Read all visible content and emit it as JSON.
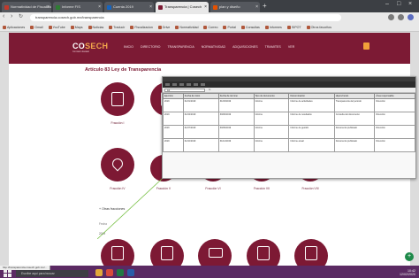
{
  "browser": {
    "tabs": [
      {
        "label": "Normatividad de Fiscaliza",
        "active": false
      },
      {
        "label": "Informe FIS",
        "active": false
      },
      {
        "label": "Cuenta 2019",
        "active": false
      },
      {
        "label": "Transparencia | Cosech",
        "active": true
      },
      {
        "label": "plan y diseño",
        "active": false
      }
    ],
    "new_tab": "+",
    "url": "transparencia.cosech.gob.mx/transparencia",
    "bookmarks": [
      "Aplicaciones",
      "Gmail",
      "YouTube",
      "Maps",
      "Noticias",
      "Traducir",
      "Fiscalizacion",
      "Drive",
      "Normatividad",
      "Correo",
      "Portal",
      "Consultas",
      "Informes",
      "SIPOT",
      "Otros favoritos"
    ]
  },
  "site": {
    "logo": {
      "text_a": "CO",
      "text_b": "SECH",
      "tagline": "Comision Estatal"
    },
    "nav": [
      "INICIO",
      "DIRECTORIO",
      "TRANSPARENCIA",
      "NORMATIVIDAD",
      "ADQUISICIONES",
      "TRAMITES",
      "VER"
    ],
    "page_title": "Artículo 83 Ley de Transparencia",
    "tiles_row1": [
      {
        "label": "Fracción I"
      },
      {
        "label": "Fracción II"
      }
    ],
    "tiles_row2": [
      {
        "label": "Fracción IV"
      },
      {
        "label": "Fracción V"
      },
      {
        "label": "Fracción VI"
      },
      {
        "label": "Fracción VII"
      },
      {
        "label": "Fracción VIII"
      }
    ],
    "tiles_row3": [
      {
        "label": ""
      },
      {
        "label": ""
      },
      {
        "label": ""
      },
      {
        "label": ""
      },
      {
        "label": ""
      }
    ],
    "sublink": "+ Otras fracciones",
    "small_note": "Fecha",
    "small_value": "2019"
  },
  "overlay": {
    "namebox": "A1",
    "fx": "fx",
    "columns": [
      "Ejercicio",
      "Fecha de inicio",
      "Fecha de término",
      "Tipo de documento",
      "Denominación",
      "Hipervínculo",
      "Área responsable"
    ],
    "rows": [
      [
        "2019",
        "01/01/2019",
        "31/03/2019",
        "Informe",
        "Informe de actividades",
        "Transparencia del periodo",
        "Dirección"
      ],
      [
        "2019",
        "01/04/2019",
        "30/06/2019",
        "Informe",
        "Informe de resultados",
        "Consulta del documento",
        "Dirección"
      ],
      [
        "2019",
        "01/07/2019",
        "30/09/2019",
        "Informe",
        "Informe de gestión",
        "Documento publicado",
        "Dirección"
      ],
      [
        "2019",
        "01/10/2019",
        "31/12/2019",
        "Informe",
        "Informe anual",
        "Documento publicado",
        "Dirección"
      ]
    ]
  },
  "taskbar": {
    "status_url": "http://transparencia.cosech.gob.mx/...",
    "search_placeholder": "Escribe aquí para buscar",
    "time": "10:42",
    "date": "12/02/2020"
  },
  "colors": {
    "brand": "#7c1a34",
    "accent": "#f0a13a",
    "taskbar": "#5b2a63"
  }
}
